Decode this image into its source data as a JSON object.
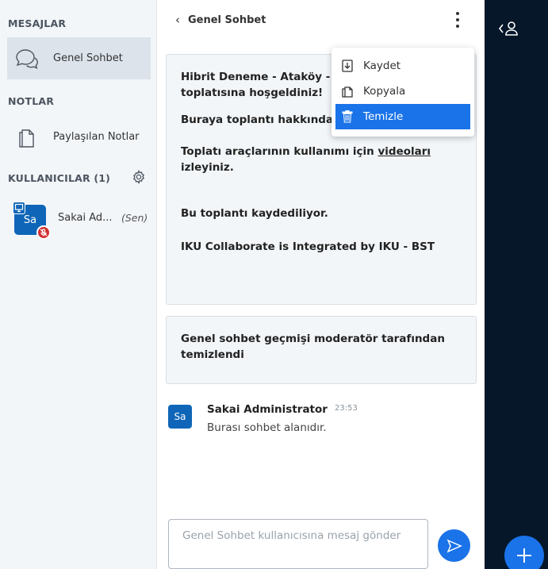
{
  "sidebar": {
    "messages_title": "MESAJLAR",
    "public_chat_label": "Genel Sohbet",
    "notes_title": "NOTLAR",
    "shared_notes_label": "Paylaşılan Notlar",
    "users_title": "KULLANICILAR (1)",
    "users": [
      {
        "initials": "Sa",
        "name": "Sakai Ad...",
        "you_label": "(Sen)"
      }
    ]
  },
  "chat": {
    "title": "Genel Sohbet",
    "welcome": {
      "line1_bold": "Hibrit Deneme - Ataköy -",
      "line1b": "toplatısına hoşgeldiniz!",
      "line2": "Buraya toplantı hakkında açıklama giriniz",
      "line3_pre": "Toplatı araçlarının kullanımı için ",
      "line3_link": "videoları",
      "line3_post": "izleyiniz.",
      "line4_bold": "Bu toplantı kaydediliyor.",
      "line5": "IKU Collaborate is Integrated by IKU - BST"
    },
    "cleared_notice": "Genel sohbet geçmişi moderatör tarafından temizlendi",
    "messages": [
      {
        "initials": "Sa",
        "sender": "Sakai Administrator",
        "time": "23:53",
        "text": "Burası sohbet alanıdır."
      }
    ],
    "composer_placeholder": "Genel Sohbet kullanıcısına mesaj gönder"
  },
  "menu": {
    "items": [
      {
        "label": "Kaydet",
        "icon": "download-icon"
      },
      {
        "label": "Kopyala",
        "icon": "copy-icon"
      },
      {
        "label": "Temizle",
        "icon": "trash-icon"
      }
    ]
  },
  "colors": {
    "accent": "#1a73e8",
    "avatar": "#0f66b8",
    "rail": "#06172a",
    "sidebar_bg": "#f3f6f9"
  }
}
